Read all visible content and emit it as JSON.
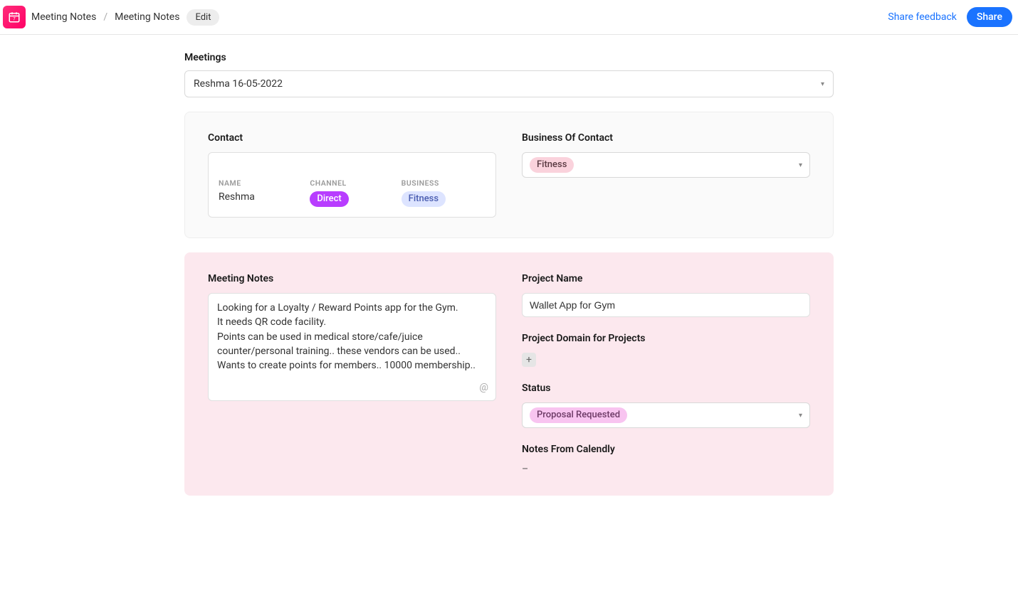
{
  "header": {
    "breadcrumb1": "Meeting Notes",
    "breadcrumb2": "Meeting Notes",
    "edit_label": "Edit",
    "share_feedback": "Share feedback",
    "share_button": "Share"
  },
  "meetings": {
    "label": "Meetings",
    "selected": "Reshma 16-05-2022"
  },
  "contact_card": {
    "contact_label": "Contact",
    "business_of_contact_label": "Business Of Contact",
    "business_of_contact_value": "Fitness",
    "name_label": "NAME",
    "name_value": "Reshma",
    "channel_label": "CHANNEL",
    "channel_value": "Direct",
    "business_label": "BUSINESS",
    "business_value": "Fitness"
  },
  "notes_card": {
    "meeting_notes_label": "Meeting Notes",
    "meeting_notes_text": "Looking for a Loyalty / Reward Points app for the Gym.\nIt needs QR code facility.\nPoints can be used in medical store/cafe/juice counter/personal training.. these vendors can be used..\nWants to create points for members.. 10000 membership..",
    "project_name_label": "Project Name",
    "project_name_value": "Wallet App for Gym",
    "project_domain_label": "Project Domain for Projects",
    "status_label": "Status",
    "status_value": "Proposal Requested",
    "calendly_label": "Notes From Calendly",
    "calendly_value": "–",
    "at_symbol": "@",
    "plus_symbol": "+"
  }
}
